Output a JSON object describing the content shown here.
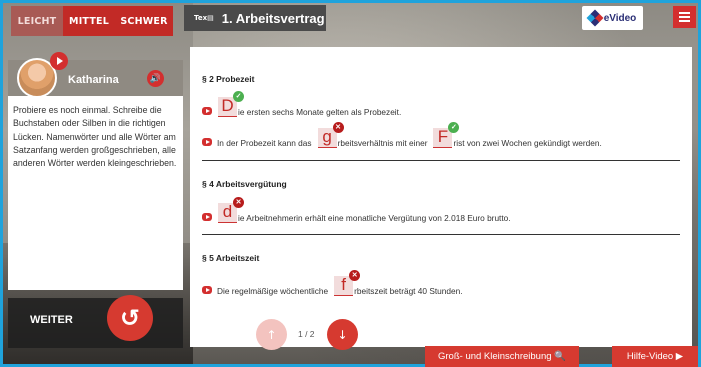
{
  "levels": [
    "LEICHT",
    "MITTEL",
    "SCHWER"
  ],
  "header": {
    "tex_icon": "Tex▤",
    "title": "1. Arbeitsvertrag",
    "logo_text": "eVideo"
  },
  "speaker": {
    "name": "Katharina",
    "instructions": "Probiere es noch einmal. Schreibe die Buchstaben oder Silben in die richtigen Lücken. Namenwörter und alle Wörter am Satzanfang werden großgeschrieben, alle anderen Wörter werden kleingeschrieben."
  },
  "weiter": {
    "label": "WEITER",
    "icon": "↺"
  },
  "sections": {
    "s1": {
      "heading": "§ 2 Probezeit",
      "l1_blank": "D",
      "l1_text": "ie ersten sechs Monate gelten als Probezeit.",
      "l2_pre": "In der Probezeit kann das",
      "l2_blank1": "g",
      "l2_mid": "rbeitsverhältnis mit einer",
      "l2_blank2": "F",
      "l2_post": "rist von zwei Wochen gekündigt werden."
    },
    "s2": {
      "heading": "§ 4 Arbeitsvergütung",
      "l1_blank": "d",
      "l1_text": "ie Arbeitnehmerin erhält eine monatliche Vergütung von 2.018 Euro brutto."
    },
    "s3": {
      "heading": "§ 5 Arbeitszeit",
      "l1_pre": "Die regelmäßige wöchentliche",
      "l1_blank": "f",
      "l1_post": "rbeitszeit beträgt 40 Stunden."
    }
  },
  "pager": {
    "current": 1,
    "total": 2,
    "label": "1 / 2"
  },
  "buttons": {
    "gross_klein": "Groß- und Kleinschreibung 🔍",
    "hilfe_video": "Hilfe-Video ▶"
  },
  "colors": {
    "accent": "#d63a30",
    "frame": "#1fa3dc",
    "correct": "#4caf50",
    "wrong": "#b71c1c"
  }
}
